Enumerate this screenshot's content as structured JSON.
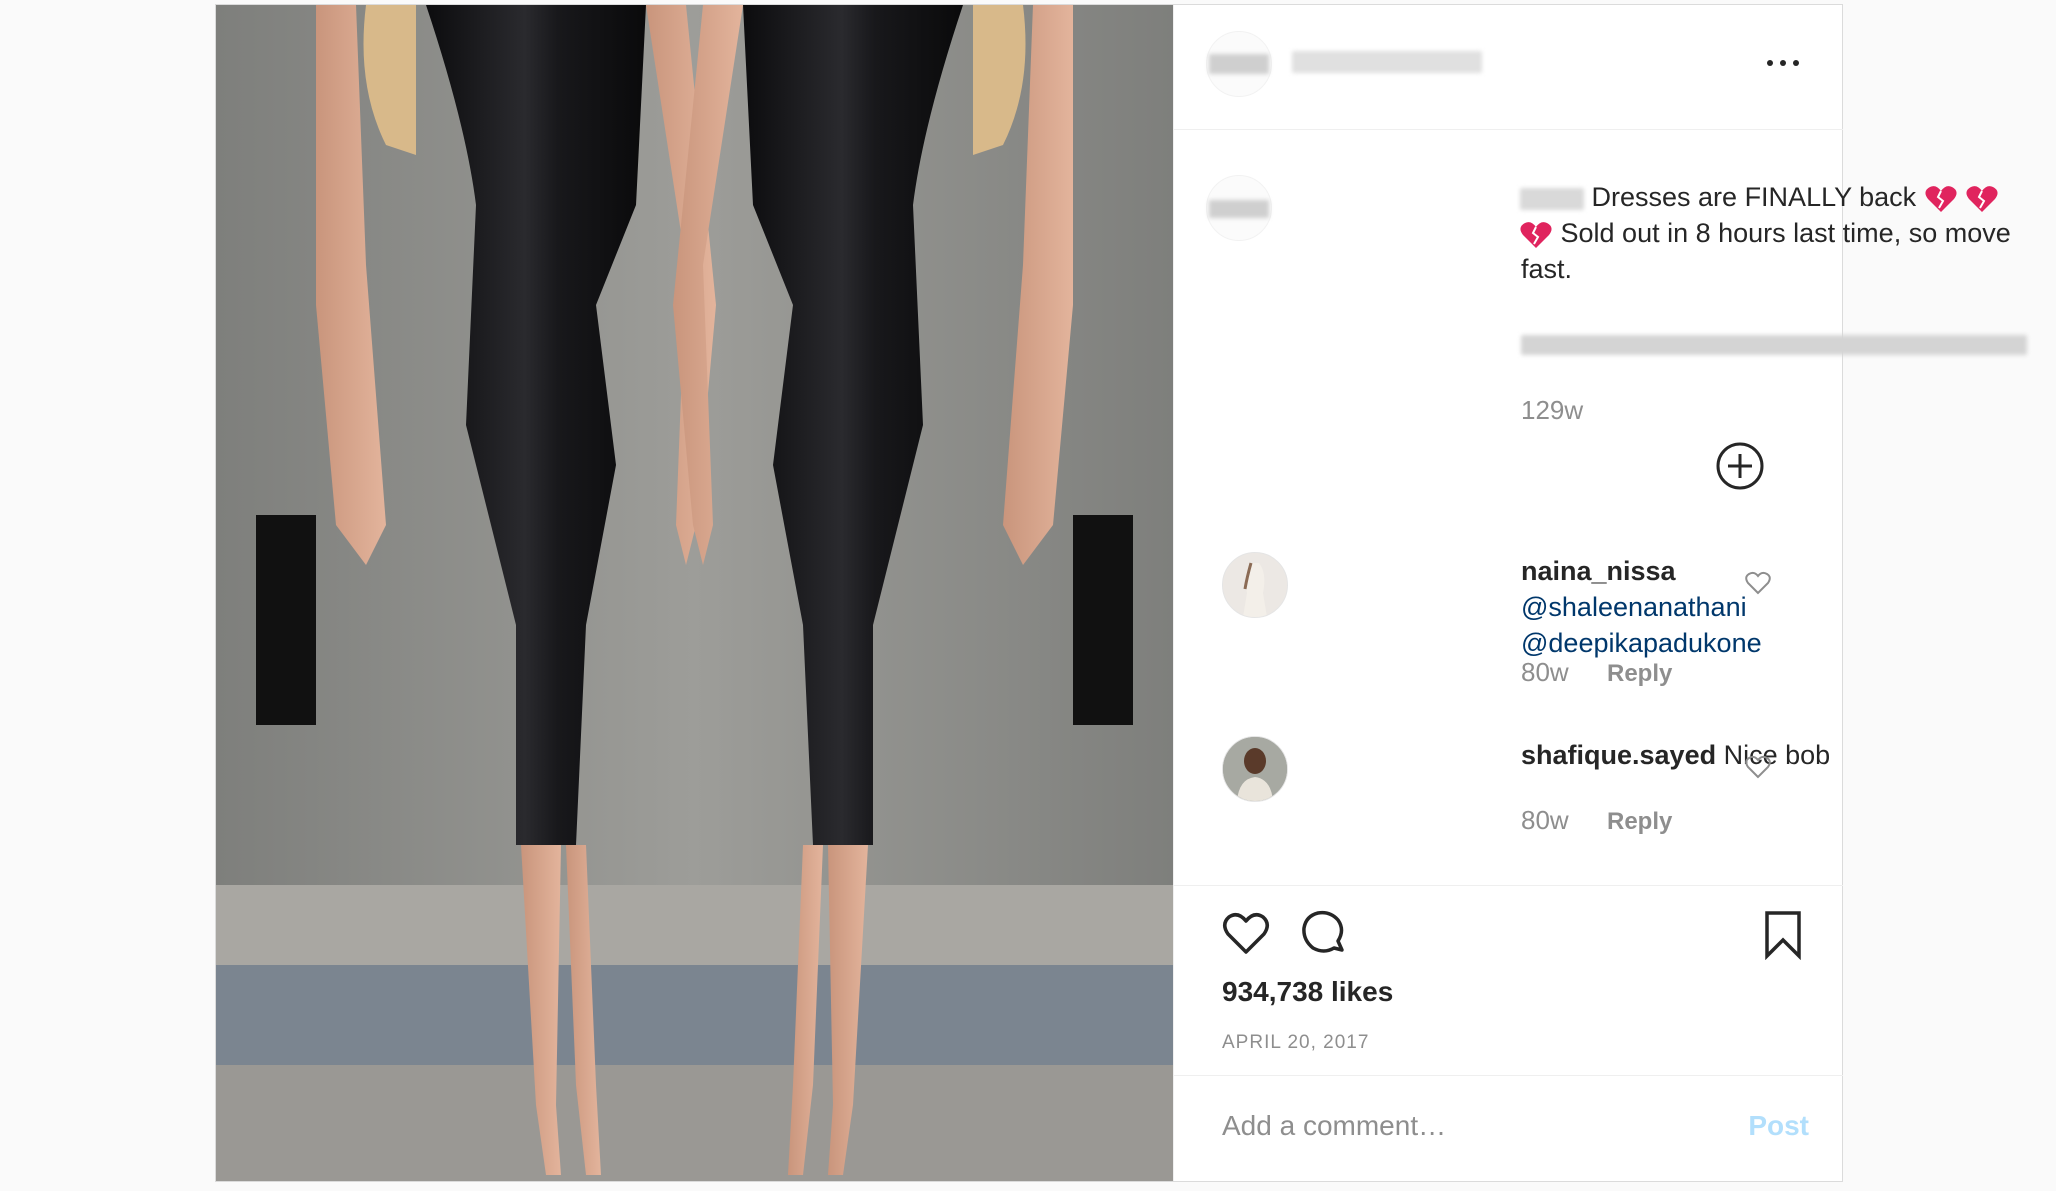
{
  "post": {
    "caption": {
      "text_line1": "Dresses are FINALLY back",
      "text_line2": "Sold out in 8 hours last time, so move",
      "text_line3": "fast.",
      "emoji": "broken-heart-emoji",
      "time": "129w"
    },
    "comments": [
      {
        "username": "naina_nissa",
        "mention1": "@shaleenanathani",
        "mention2": "@deepikapadukone",
        "time": "80w",
        "reply_label": "Reply"
      },
      {
        "username": "shafique.sayed",
        "text": "Nice bob",
        "time": "80w",
        "reply_label": "Reply"
      }
    ],
    "likes": "934,738 likes",
    "date": "APRIL 20, 2017",
    "comment_placeholder": "Add a comment…",
    "post_button": "Post"
  },
  "colors": {
    "link": "#00376b",
    "muted": "#8e8e8e",
    "post_disabled": "#b2dffc"
  },
  "icons": [
    "more-options-icon",
    "load-more-icon",
    "heart-icon",
    "comment-icon",
    "bookmark-icon"
  ]
}
